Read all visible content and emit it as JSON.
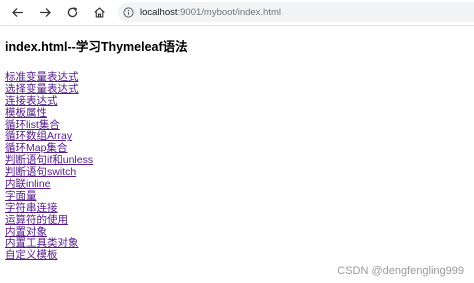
{
  "browser": {
    "url_host": "localhost",
    "url_path": ":9001/myboot/index.html",
    "icons": [
      "back-arrow-icon",
      "forward-arrow-icon",
      "reload-icon",
      "home-icon",
      "info-icon"
    ]
  },
  "page": {
    "heading": "index.html--学习Thymeleaf语法",
    "links": [
      "标准变量表达式",
      "选择变量表达式",
      "连接表达式",
      "模板属性",
      "循环list集合",
      "循环数组Array",
      "循环Map集合",
      "判断语句if和unless",
      "判断语句switch",
      "内联inline",
      "字面量",
      "字符串连接",
      "运算符的使用",
      "内置对象",
      "内置工具类对象",
      "自定义模板"
    ],
    "link_color": "#551a8b"
  },
  "watermark": "CSDN @dengfengling999"
}
